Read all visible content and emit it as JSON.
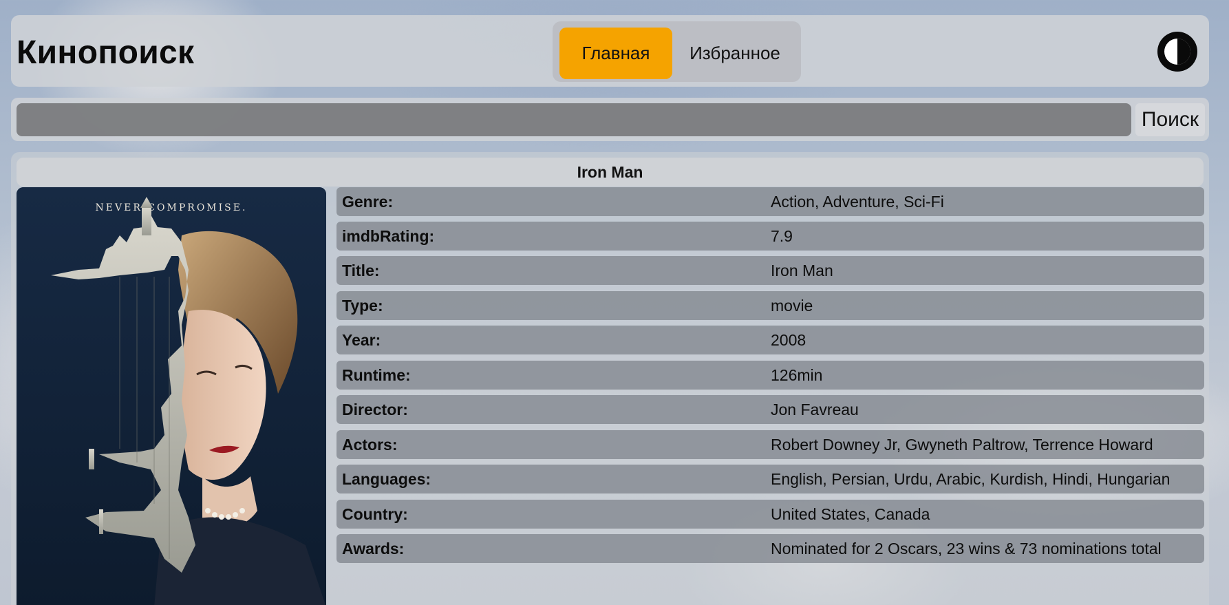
{
  "header": {
    "logo": "Кинопоиск",
    "nav": [
      {
        "label": "Главная",
        "active": true
      },
      {
        "label": "Избранное",
        "active": false
      }
    ],
    "theme_toggle_icon": "contrast-icon"
  },
  "search": {
    "value": "",
    "placeholder": "",
    "button_label": "Поиск"
  },
  "movie": {
    "title": "Iron Man",
    "poster": {
      "tagline": "NEVER COMPROMISE."
    },
    "details": [
      {
        "label": "Genre:",
        "value": "Action, Adventure, Sci-Fi"
      },
      {
        "label": "imdbRating:",
        "value": "7.9"
      },
      {
        "label": "Title:",
        "value": "Iron Man"
      },
      {
        "label": "Type:",
        "value": "movie"
      },
      {
        "label": "Year:",
        "value": "2008"
      },
      {
        "label": "Runtime:",
        "value": "126min"
      },
      {
        "label": "Director:",
        "value": "Jon Favreau"
      },
      {
        "label": "Actors:",
        "value": "Robert Downey Jr, Gwyneth Paltrow, Terrence Howard"
      },
      {
        "label": "Languages:",
        "value": "English, Persian, Urdu, Arabic, Kurdish, Hindi, Hungarian"
      },
      {
        "label": "Country:",
        "value": "United States, Canada"
      },
      {
        "label": "Awards:",
        "value": "Nominated for 2 Oscars, 23 wins & 73 nominations total"
      }
    ]
  },
  "colors": {
    "accent": "#f5a300",
    "poster_background": "#13233a"
  }
}
